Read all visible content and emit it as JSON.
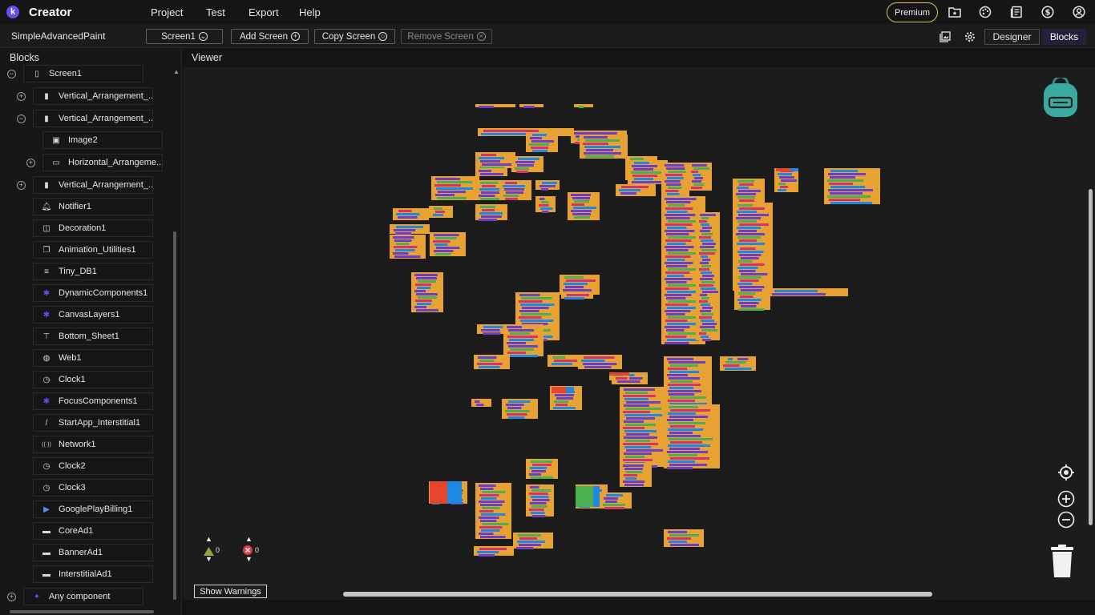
{
  "app": {
    "logo_letter": "k",
    "name": "Creator"
  },
  "menu": [
    {
      "label": "Project"
    },
    {
      "label": "Test"
    },
    {
      "label": "Export"
    },
    {
      "label": "Help"
    }
  ],
  "premium_label": "Premium",
  "top_icons": [
    "folder-star-icon",
    "palette-icon",
    "news-icon",
    "dollar-icon",
    "account-icon"
  ],
  "toolbar": {
    "project_name": "SimpleAdvancedPaint",
    "screen_select": "Screen1",
    "add_screen": "Add Screen",
    "copy_screen": "Copy Screen",
    "remove_screen": "Remove Screen",
    "designer": "Designer",
    "blocks": "Blocks"
  },
  "sidebar": {
    "title": "Blocks",
    "items": [
      {
        "label": "Screen1",
        "icon": "phone-icon",
        "toggle": "minus"
      },
      {
        "label": "Vertical_Arrangement_...",
        "icon": "vertical-arrangement-icon",
        "toggle": "plus"
      },
      {
        "label": "Vertical_Arrangement_...",
        "icon": "vertical-arrangement-icon",
        "toggle": "minus"
      },
      {
        "label": "Image2",
        "icon": "image-icon",
        "toggle": ""
      },
      {
        "label": "Horizontal_Arrangeme...",
        "icon": "horizontal-arrangement-icon",
        "toggle": "plus"
      },
      {
        "label": "Vertical_Arrangement_...",
        "icon": "vertical-arrangement-icon",
        "toggle": "plus"
      },
      {
        "label": "Notifier1",
        "icon": "bell-icon",
        "toggle": ""
      },
      {
        "label": "Decoration1",
        "icon": "decoration-icon",
        "toggle": ""
      },
      {
        "label": "Animation_Utilities1",
        "icon": "animation-icon",
        "toggle": ""
      },
      {
        "label": "Tiny_DB1",
        "icon": "database-icon",
        "toggle": ""
      },
      {
        "label": "DynamicComponents1",
        "icon": "puzzle-icon",
        "toggle": ""
      },
      {
        "label": "CanvasLayers1",
        "icon": "puzzle-icon",
        "toggle": ""
      },
      {
        "label": "Bottom_Sheet1",
        "icon": "bottom-sheet-icon",
        "toggle": ""
      },
      {
        "label": "Web1",
        "icon": "globe-icon",
        "toggle": ""
      },
      {
        "label": "Clock1",
        "icon": "clock-icon",
        "toggle": ""
      },
      {
        "label": "FocusComponents1",
        "icon": "puzzle-icon",
        "toggle": ""
      },
      {
        "label": "StartApp_Interstitial1",
        "icon": "slash-icon",
        "toggle": ""
      },
      {
        "label": "Network1",
        "icon": "network-icon",
        "toggle": ""
      },
      {
        "label": "Clock2",
        "icon": "clock-icon",
        "toggle": ""
      },
      {
        "label": "Clock3",
        "icon": "clock-icon",
        "toggle": ""
      },
      {
        "label": "GooglePlayBilling1",
        "icon": "play-icon",
        "toggle": ""
      },
      {
        "label": "CoreAd1",
        "icon": "ad-icon",
        "toggle": ""
      },
      {
        "label": "BannerAd1",
        "icon": "ad-icon",
        "toggle": ""
      },
      {
        "label": "InterstitialAd1",
        "icon": "ad-icon",
        "toggle": ""
      },
      {
        "label": "Any component",
        "icon": "sparkle-icon",
        "toggle": "plus"
      }
    ]
  },
  "viewer": {
    "title": "Viewer",
    "warnings_count": "0",
    "errors_count": "0",
    "show_warnings": "Show Warnings"
  },
  "colors": {
    "accent": "#6c4cf0",
    "premium_border": "#d9c15c",
    "backpack": "#3aa9a0",
    "block_orange": "#e8a234",
    "block_purple": "#6a3fc9",
    "block_green": "#4caf50",
    "block_pink": "#d6336c",
    "block_blue": "#1e88e5",
    "block_red": "#e8462c"
  }
}
